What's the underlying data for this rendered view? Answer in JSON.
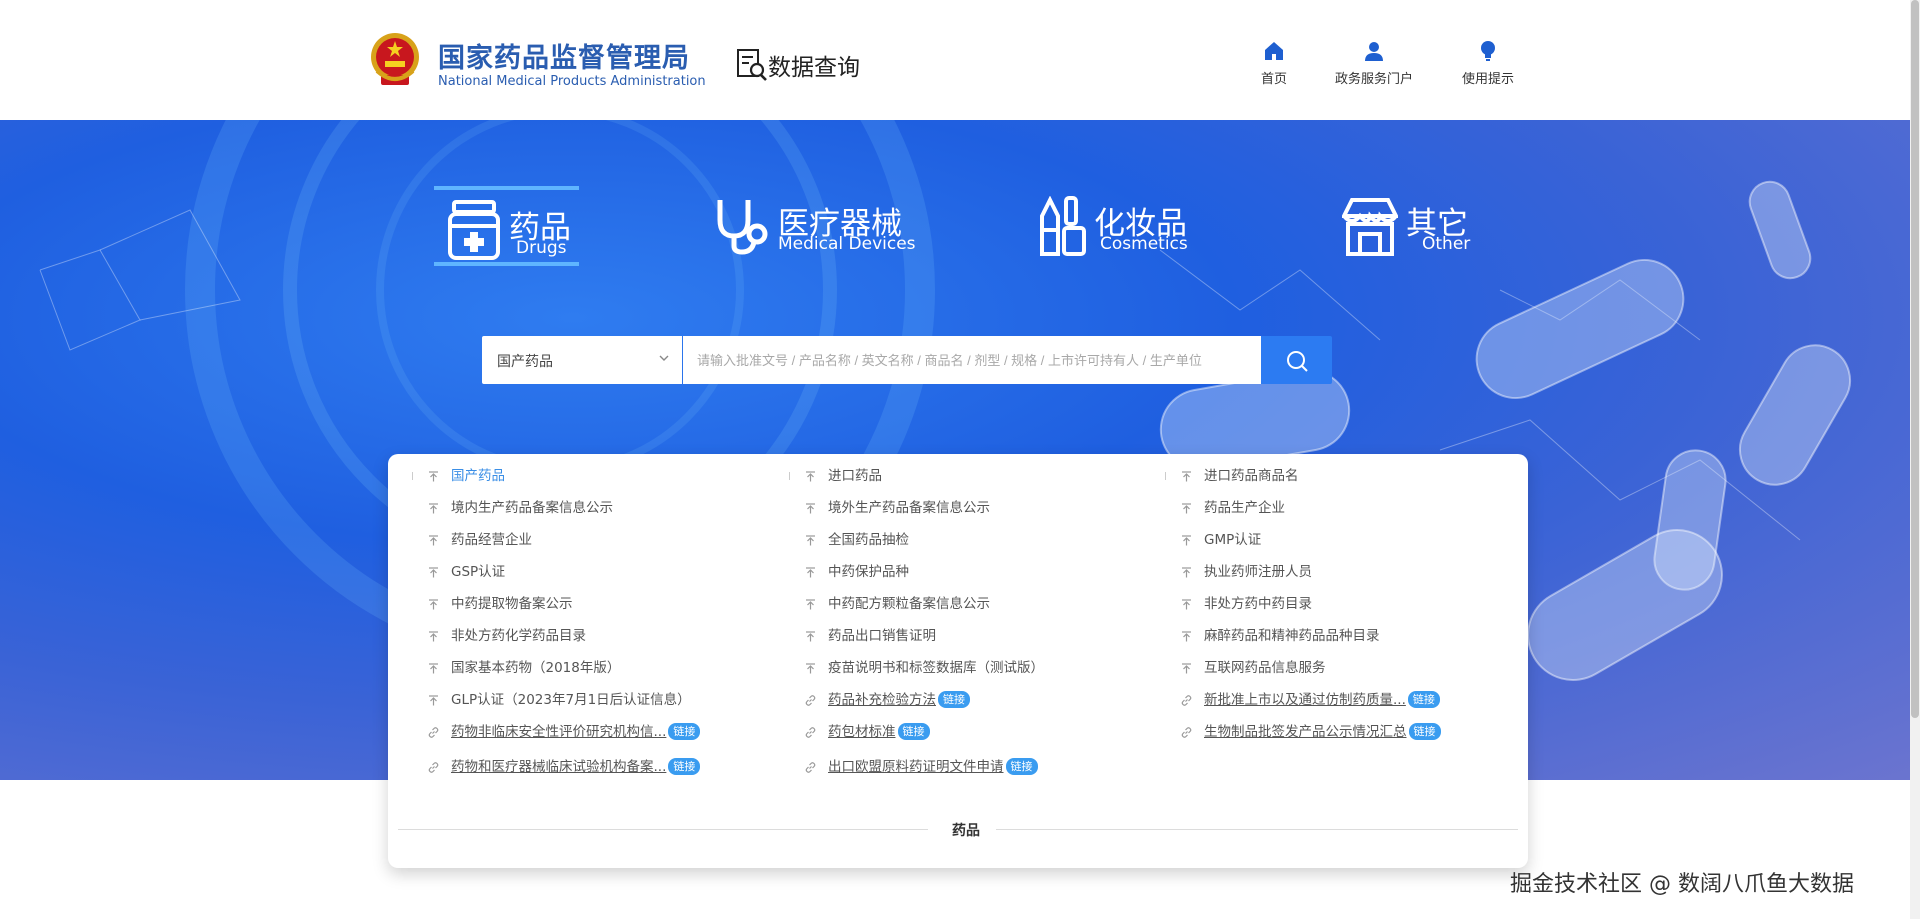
{
  "header": {
    "org_name_cn": "国家药品监督管理局",
    "org_name_en": "National Medical Products Administration",
    "query_label": "数据查询",
    "nav": [
      {
        "label": "首页",
        "icon": "home-icon"
      },
      {
        "label": "政务服务门户",
        "icon": "user-icon"
      },
      {
        "label": "使用提示",
        "icon": "lightbulb-icon"
      }
    ]
  },
  "categories": [
    {
      "cn": "药品",
      "en": "Drugs",
      "icon": "medicine-bottle-icon",
      "active": true
    },
    {
      "cn": "医疗器械",
      "en": "Medical Devices",
      "icon": "stethoscope-icon",
      "active": false
    },
    {
      "cn": "化妆品",
      "en": "Cosmetics",
      "icon": "cosmetics-icon",
      "active": false
    },
    {
      "cn": "其它",
      "en": "Other",
      "icon": "store-icon",
      "active": false
    }
  ],
  "search": {
    "selected": "国产药品",
    "placeholder": "请输入批准文号 / 产品名称 / 英文名称 / 商品名 / 剂型 / 规格 / 上市许可持有人 / 生产单位",
    "button_icon": "search-icon"
  },
  "panel": {
    "columns": [
      [
        {
          "text": "国产药品",
          "type": "data"
        },
        {
          "text": "境内生产药品备案信息公示",
          "type": "data"
        },
        {
          "text": "药品经营企业",
          "type": "data"
        },
        {
          "text": "GSP认证",
          "type": "data"
        },
        {
          "text": "中药提取物备案公示",
          "type": "data"
        },
        {
          "text": "非处方药化学药品目录",
          "type": "data"
        },
        {
          "text": "国家基本药物（2018年版）",
          "type": "data"
        },
        {
          "text": "GLP认证（2023年7月1日后认证信息）",
          "type": "data"
        },
        {
          "text": "药物非临床安全性评价研究机构信...",
          "type": "link",
          "badge": "链接"
        },
        {
          "text": "药物和医疗器械临床试验机构备案...",
          "type": "link",
          "badge": "链接"
        }
      ],
      [
        {
          "text": "进口药品",
          "type": "data"
        },
        {
          "text": "境外生产药品备案信息公示",
          "type": "data"
        },
        {
          "text": "全国药品抽检",
          "type": "data"
        },
        {
          "text": "中药保护品种",
          "type": "data"
        },
        {
          "text": "中药配方颗粒备案信息公示",
          "type": "data"
        },
        {
          "text": "药品出口销售证明",
          "type": "data"
        },
        {
          "text": "疫苗说明书和标签数据库（测试版）",
          "type": "data"
        },
        {
          "text": "药品补充检验方法",
          "type": "link",
          "badge": "链接"
        },
        {
          "text": "药包材标准",
          "type": "link",
          "badge": "链接"
        },
        {
          "text": "出口欧盟原料药证明文件申请",
          "type": "link",
          "badge": "链接"
        }
      ],
      [
        {
          "text": "进口药品商品名",
          "type": "data"
        },
        {
          "text": "药品生产企业",
          "type": "data"
        },
        {
          "text": "GMP认证",
          "type": "data"
        },
        {
          "text": "执业药师注册人员",
          "type": "data"
        },
        {
          "text": "非处方药中药目录",
          "type": "data"
        },
        {
          "text": "麻醉药品和精神药品品种目录",
          "type": "data"
        },
        {
          "text": "互联网药品信息服务",
          "type": "data"
        },
        {
          "text": "新批准上市以及通过仿制药质量...",
          "type": "link",
          "badge": "链接"
        },
        {
          "text": "生物制品批签发产品公示情况汇总",
          "type": "link",
          "badge": "链接"
        }
      ]
    ],
    "footer_label": "药品"
  },
  "watermark": "掘金技术社区 @ 数阔八爪鱼大数据",
  "colors": {
    "brand": "#2a5db0",
    "accent": "#2c7bf2",
    "badge": "#3a9cf0",
    "active_item": "#3a8ee6"
  }
}
